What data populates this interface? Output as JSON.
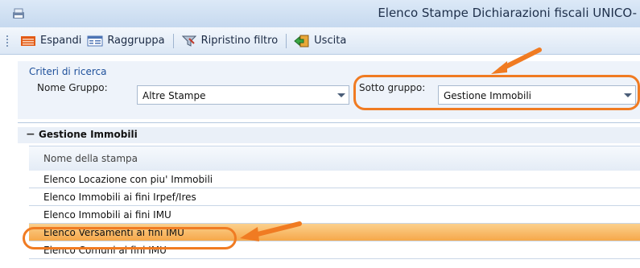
{
  "window": {
    "title": "Elenco Stampe Dichiarazioni fiscali UNICO-"
  },
  "toolbar": {
    "expand_label": "Espandi",
    "group_label": "Raggruppa",
    "reset_filter_label": "Ripristino filtro",
    "exit_label": "Uscita"
  },
  "criteria": {
    "title": "Criteri di ricerca",
    "group_name_label": "Nome Gruppo:",
    "group_name_value": "Altre Stampe",
    "subgroup_label": "Sotto gruppo:",
    "subgroup_value": "Gestione Immobili"
  },
  "grid": {
    "group_toggle": "−",
    "group_name": "Gestione Immobili",
    "column_header": "Nome della stampa",
    "rows": [
      {
        "label": "Elenco Locazione con piu' Immobili"
      },
      {
        "label": "Elenco Immobili ai fini Irpef/Ires"
      },
      {
        "label": "Elenco Immobili ai fini IMU"
      },
      {
        "label": "Elenco Versamenti ai fini IMU"
      },
      {
        "label": "Elenco Comuni ai fini IMU"
      }
    ],
    "selected_row": "Elenco Versamenti ai fini IMU"
  },
  "colors": {
    "highlight": "#f07b22",
    "selection": "#f6a84a",
    "accent_text": "#1d4f9a"
  },
  "icons": [
    "app-icon",
    "expand-icon",
    "group-icon",
    "filter-icon",
    "exit-icon",
    "dropdown-arrow-icon",
    "annotation-arrow-icon"
  ]
}
